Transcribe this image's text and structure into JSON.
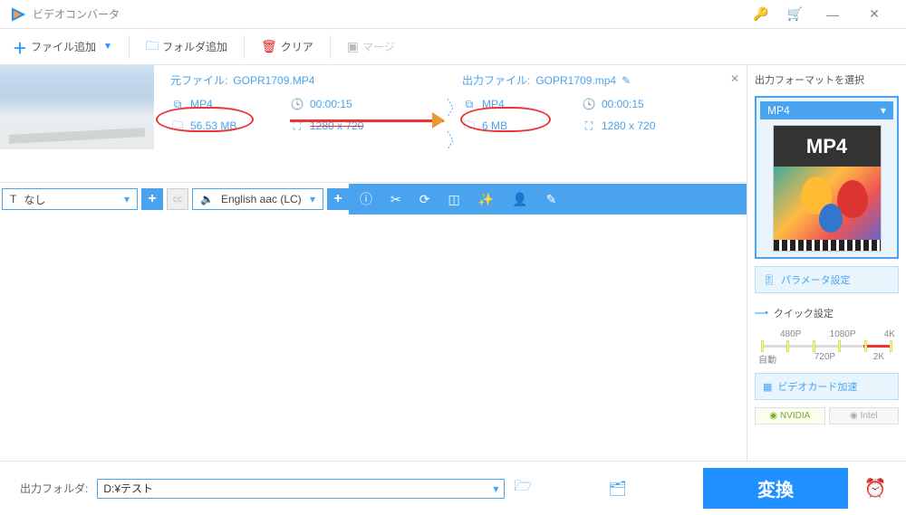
{
  "app": {
    "title": "ビデオコンバータ"
  },
  "toolbar": {
    "add_file": "ファイル追加",
    "add_folder": "フォルダ追加",
    "clear": "クリア",
    "merge": "マージ"
  },
  "item": {
    "source": {
      "label": "元ファイル:",
      "name": "GOPR1709.MP4",
      "format": "MP4",
      "duration": "00:00:15",
      "size": "56.53 MB",
      "resolution": "1280 x 720"
    },
    "output": {
      "label": "出力ファイル:",
      "name": "GOPR1709.mp4",
      "format": "MP4",
      "duration": "00:00:15",
      "size": "6 MB",
      "resolution": "1280 x 720"
    },
    "subtitle_select": "なし",
    "audio_select": "English aac (LC)"
  },
  "right": {
    "title": "出力フォーマットを選択",
    "format_name": "MP4",
    "format_badge": "MP4",
    "param_btn": "パラメータ設定",
    "quick_title": "クイック設定",
    "ticks_top": [
      "480P",
      "1080P",
      "4K"
    ],
    "ticks_bot": [
      "自動",
      "720P",
      "2K"
    ],
    "gpu_btn": "ビデオカード加速",
    "nvidia": "NVIDIA",
    "intel": "Intel"
  },
  "footer": {
    "label": "出力フォルダ:",
    "path": "D:¥テスト",
    "convert": "変換"
  }
}
